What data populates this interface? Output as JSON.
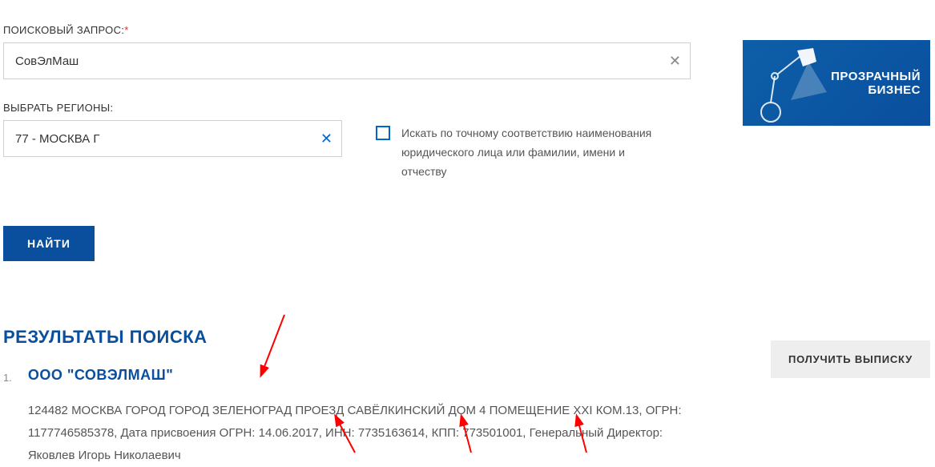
{
  "search": {
    "label": "ПОИСКОВЫЙ ЗАПРОС:",
    "value": "СовЭлМаш"
  },
  "region": {
    "label": "ВЫБРАТЬ РЕГИОНЫ:",
    "value": "77 - МОСКВА Г"
  },
  "checkbox": {
    "label": "Искать по точному соответствию наименования юридического лица или фамилии, имени и отчеству"
  },
  "findButton": "НАЙТИ",
  "results": {
    "title": "РЕЗУЛЬТАТЫ ПОИСКА",
    "items": [
      {
        "num": "1.",
        "name": "ООО \"СОВЭЛМАШ\"",
        "details": "124482 МОСКВА ГОРОД ГОРОД ЗЕЛЕНОГРАД ПРОЕЗД САВЁЛКИНСКИЙ ДОМ 4 ПОМЕЩЕНИЕ XXI КОМ.13, ОГРН: 1177746585378, Дата присвоения ОГРН: 14.06.2017, ИНН: 7735163614, КПП: 773501001, Генеральный Директор: Яковлев Игорь Николаевич"
      }
    ]
  },
  "banner": {
    "line1": "ПРОЗРАЧНЫЙ",
    "line2": "БИЗНЕС"
  },
  "extractButton": "ПОЛУЧИТЬ ВЫПИСКУ"
}
